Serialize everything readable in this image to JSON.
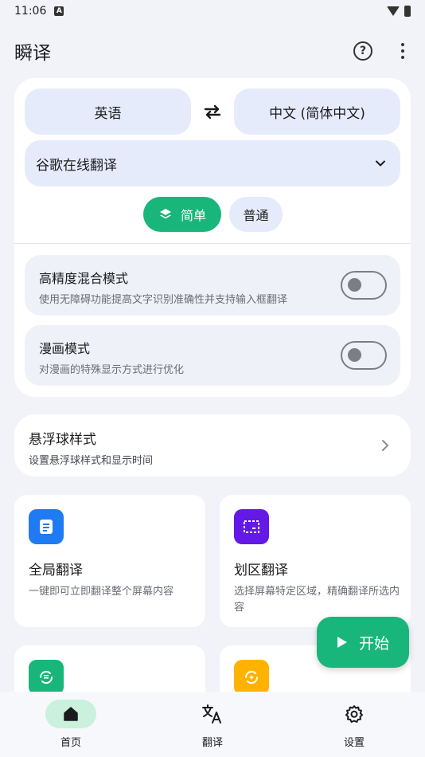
{
  "status_bar": {
    "time": "11:06",
    "notification_glyph": "A"
  },
  "app_bar": {
    "title": "瞬译",
    "help_glyph": "?"
  },
  "translate_card": {
    "source_language": "英语",
    "target_language": "中文 (简体中文)",
    "engine": "谷歌在线翻译",
    "modes": {
      "simple": "简单",
      "normal": "普通",
      "selected": "simple"
    },
    "toggles": [
      {
        "title": "高精度混合模式",
        "subtitle": "使用无障碍功能提高文字识别准确性并支持输入框翻译",
        "on": false
      },
      {
        "title": "漫画模式",
        "subtitle": "对漫画的特殊显示方式进行优化",
        "on": false
      }
    ]
  },
  "float_ball": {
    "title": "悬浮球样式",
    "subtitle": "设置悬浮球样式和显示时间"
  },
  "features": [
    {
      "title": "全局翻译",
      "subtitle": "一键即可立即翻译整个屏幕内容",
      "icon": "document-icon",
      "color": "#1f7bf2"
    },
    {
      "title": "划区翻译",
      "subtitle": "选择屏幕特定区域，精确翻译所选内容",
      "icon": "region-select-icon",
      "color": "#6419e6"
    },
    {
      "title": "",
      "subtitle": "",
      "icon": "refresh-text-icon",
      "color": "#18b67a"
    },
    {
      "title": "",
      "subtitle": "",
      "icon": "sync-icon",
      "color": "#ffb300"
    }
  ],
  "fab": {
    "label": "开始"
  },
  "nav": [
    {
      "label": "首页",
      "active": true
    },
    {
      "label": "翻译",
      "active": false
    },
    {
      "label": "设置",
      "active": false
    }
  ],
  "colors": {
    "accent": "#18b67a",
    "chip_bg": "#e6ebfb",
    "background": "#f1f3f8"
  }
}
